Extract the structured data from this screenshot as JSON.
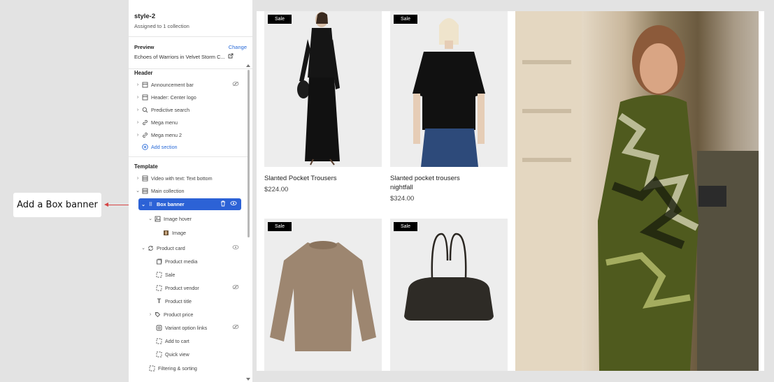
{
  "callout": {
    "text": "Add a Box banner"
  },
  "sidebar": {
    "title": "style-2",
    "subtitle": "Assigned to 1 collection",
    "preview_label": "Preview",
    "preview_change": "Change",
    "preview_value": "Echoes of Warriors in Velvet Storm C...",
    "header_section": "Header",
    "header_items": [
      {
        "label": "Announcement bar",
        "icon": "section-icon",
        "hidden": true
      },
      {
        "label": "Header: Center logo",
        "icon": "section-icon"
      },
      {
        "label": "Predictive search",
        "icon": "search-icon"
      },
      {
        "label": "Mega menu",
        "icon": "link-icon"
      },
      {
        "label": "Mega menu 2",
        "icon": "link-icon"
      }
    ],
    "add_section": "Add section",
    "template_section": "Template",
    "template_items": [
      {
        "label": "Video with text: Text bottom"
      },
      {
        "label": "Main collection"
      },
      {
        "label": "Box banner"
      },
      {
        "label": "Image hover"
      },
      {
        "label": "Image"
      },
      {
        "label": "Product card"
      },
      {
        "label": "Product media"
      },
      {
        "label": "Sale"
      },
      {
        "label": "Product vendor"
      },
      {
        "label": "Product title"
      },
      {
        "label": "Product price"
      },
      {
        "label": "Variant option links"
      },
      {
        "label": "Add to cart"
      },
      {
        "label": "Quick view"
      },
      {
        "label": "Filtering & sorting"
      }
    ]
  },
  "products": [
    {
      "badge": "Sale",
      "title": "Slanted Pocket Trousers",
      "price": "$224.00"
    },
    {
      "badge": "Sale",
      "title": "Slanted pocket trousers nightfall",
      "price": "$324.00"
    },
    {
      "badge": "Sale"
    },
    {
      "badge": "Sale"
    }
  ],
  "colors": {
    "accent": "#2c62d6",
    "link": "#2a6bd8",
    "arrow": "#d64545"
  }
}
